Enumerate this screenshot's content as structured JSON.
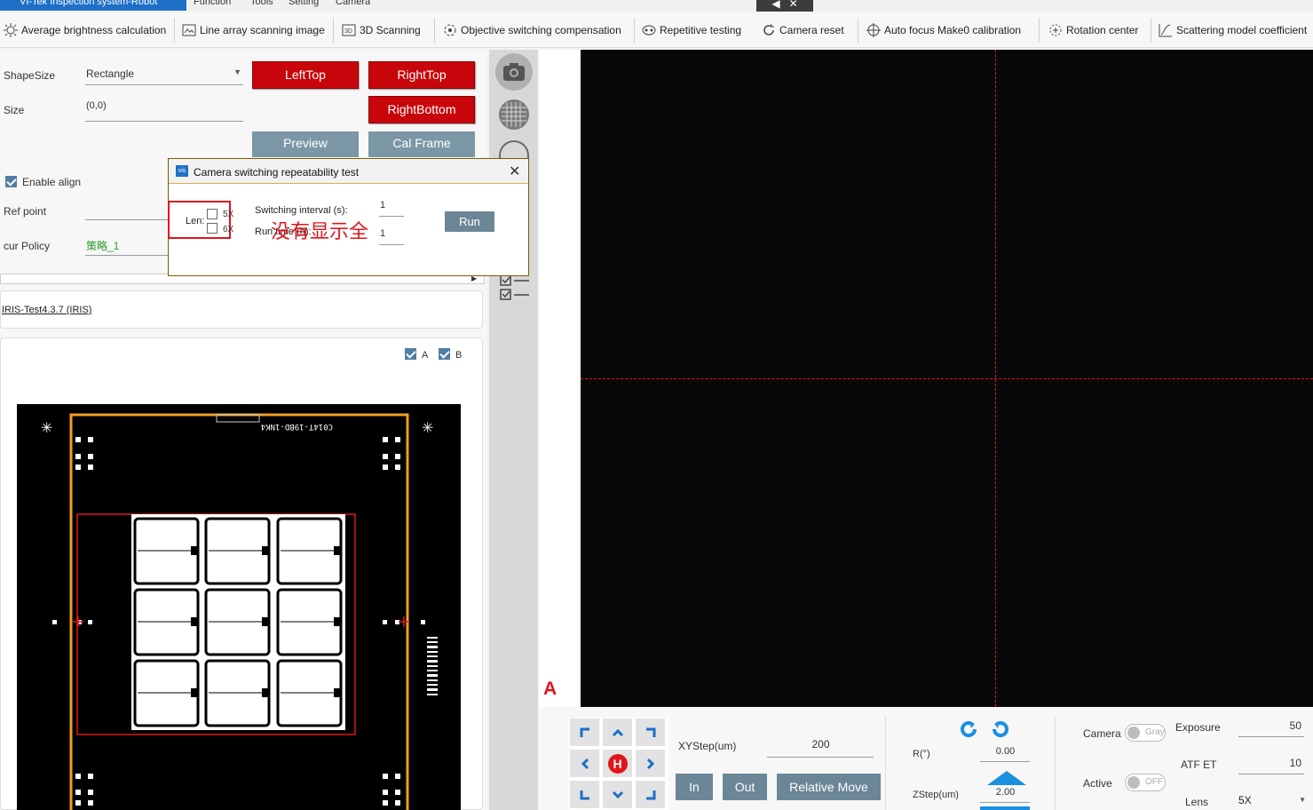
{
  "menubar": {
    "app_title": "VI-Tek Inspection system-Robot",
    "menus": [
      "Function",
      "Tools",
      "Setting",
      "Camera"
    ]
  },
  "toolbar": {
    "items": [
      {
        "label": "Average brightness calculation",
        "icon": "brightness-icon"
      },
      {
        "label": "Line array scanning image",
        "icon": "line-scan-icon"
      },
      {
        "label": "3D Scanning",
        "icon": "3d-scan-icon"
      },
      {
        "label": "Objective switching compensation",
        "icon": "objective-switch-icon"
      },
      {
        "label": "Repetitive testing",
        "icon": "repeat-icon"
      },
      {
        "label": "Camera reset",
        "icon": "reset-icon"
      },
      {
        "label": "Auto focus Make0 calibration",
        "icon": "crosshair-icon"
      },
      {
        "label": "Rotation center",
        "icon": "rotation-center-icon"
      },
      {
        "label": "Scattering model coefficient",
        "icon": "curve-icon"
      }
    ]
  },
  "left": {
    "shape_size_label": "ShapeSize",
    "shape_size_value": "Rectangle",
    "size_label": "Size",
    "size_value": "(0,0)",
    "btn_lefttop": "LeftTop",
    "btn_righttop": "RightTop",
    "btn_rightbottom": "RightBottom",
    "btn_preview": "Preview",
    "btn_calframe": "Cal Frame",
    "enable_align_label": "Enable align",
    "enable_align_checked": true,
    "ref_point_label": "Ref point",
    "cur_policy_label": "cur Policy",
    "cur_policy_value": "策略_1",
    "recipe_link": "IRIS-Test4.3.7 (IRIS)",
    "chk_a_label": "A",
    "chk_b_label": "B",
    "wafer_text": "C014T-19BD-1NK4"
  },
  "dialog": {
    "title": "Camera switching repeatability test",
    "len_label": "Len:",
    "opt_5x": "5X",
    "opt_6x": "6X",
    "switch_interval_label": "Switching interval (s):",
    "switch_interval_value": "1",
    "run_time_label": "Run time (h):",
    "run_time_value": "1",
    "run_button": "Run",
    "annotation": "没有显示全"
  },
  "camera": {
    "marker_label": "A"
  },
  "bottom": {
    "xystep_label": "XYStep(um)",
    "xystep_value": "200",
    "home_label": "H",
    "btn_in": "In",
    "btn_out": "Out",
    "btn_relative": "Relative Move",
    "r_label": "R(°)",
    "r_value": "0.00",
    "zstep_label": "ZStep(um)",
    "zstep_value": "2.00",
    "camera_label": "Camera",
    "camera_toggle": "Gray",
    "active_label": "Active",
    "active_toggle": "OFF",
    "exposure_label": "Exposure",
    "exposure_value": "50",
    "atf_label": "ATF ET",
    "atf_value": "10",
    "lens_label": "Lens",
    "lens_value": "5X"
  },
  "colors": {
    "accent_red": "#c8050b",
    "title_blue": "#1f6fc6",
    "crosshair": "#e0151b",
    "frame_orange": "#f0a020"
  }
}
